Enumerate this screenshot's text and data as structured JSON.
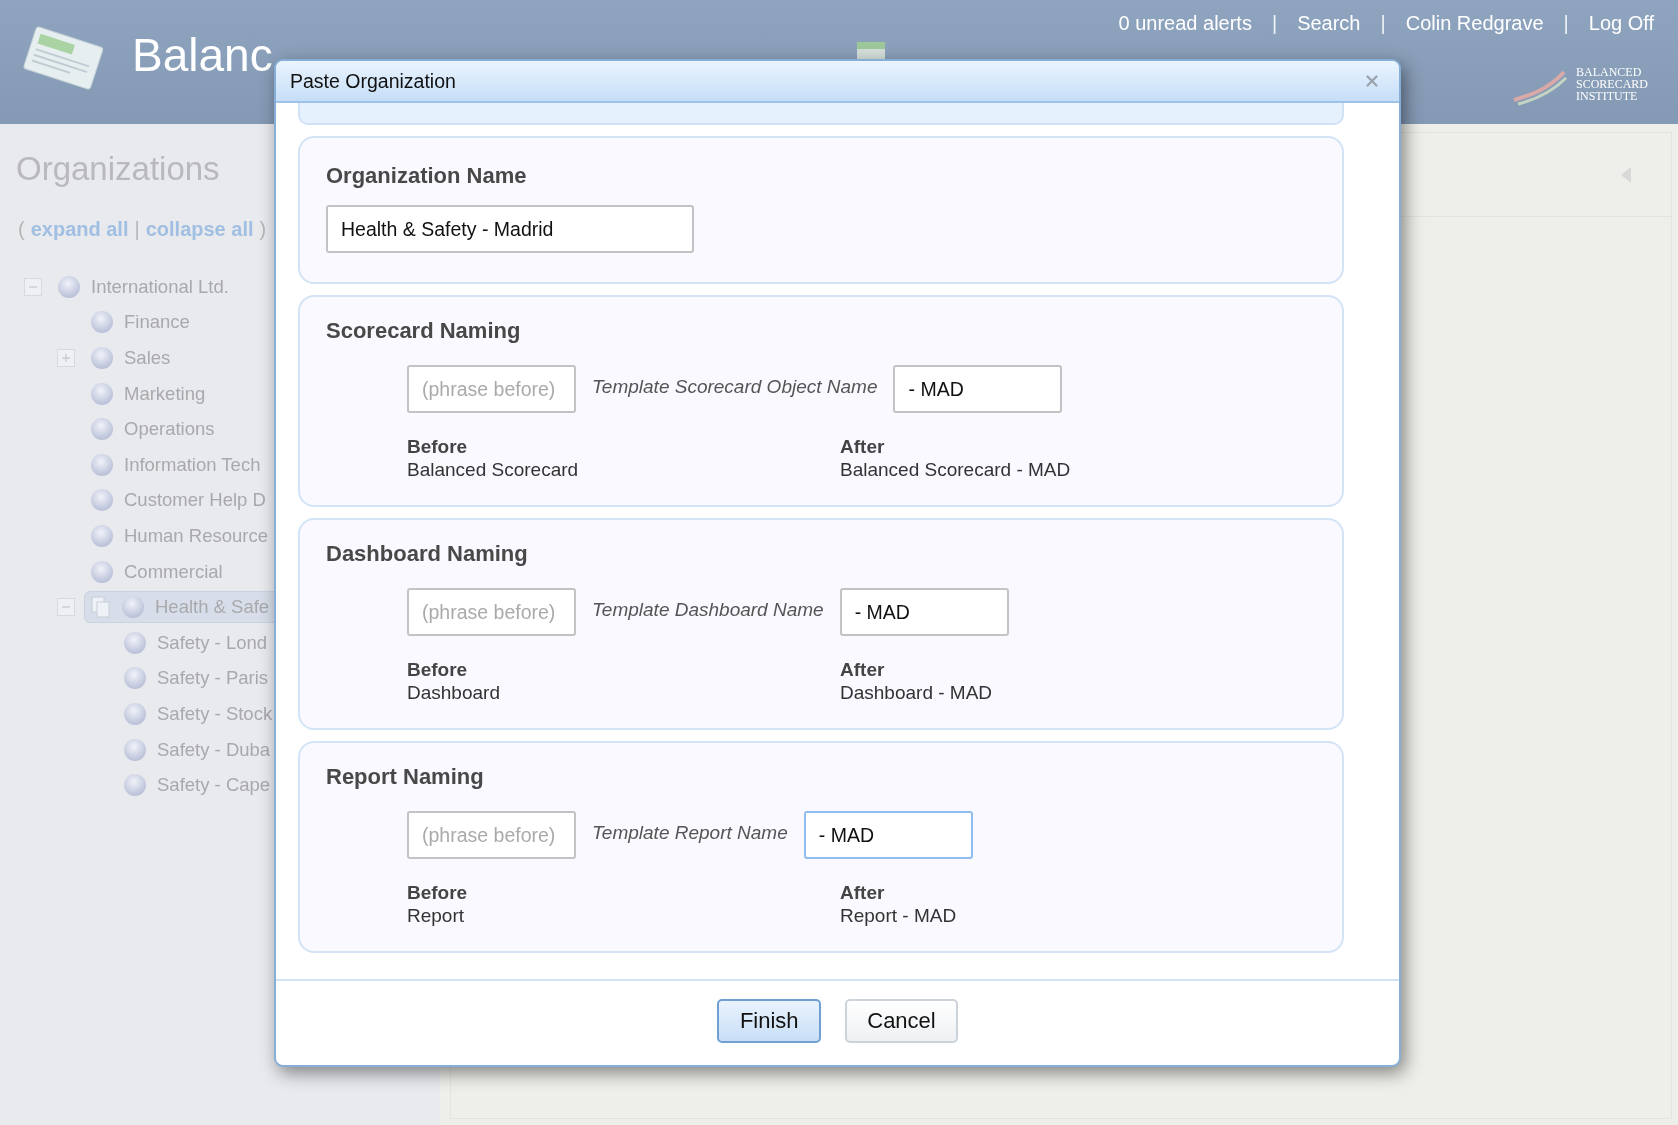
{
  "header": {
    "app_title": "Balanc",
    "top_links": [
      {
        "kind": "link",
        "label": "0 unread alerts"
      },
      {
        "kind": "separator",
        "label": "|"
      },
      {
        "kind": "link",
        "label": "Search"
      },
      {
        "kind": "separator",
        "label": "|"
      },
      {
        "kind": "link",
        "label": "Colin Redgrave"
      },
      {
        "kind": "separator",
        "label": "|"
      },
      {
        "kind": "link",
        "label": "Log Off"
      }
    ],
    "institute_logo": "BALANCED SCORECARD INSTITUTE"
  },
  "sidebar": {
    "title": "Organizations",
    "open_paren": "(",
    "expand_all": "expand all",
    "divider": "|",
    "collapse_all": "collapse all",
    "close_paren": ")",
    "tree": [
      {
        "label": "International Ltd.",
        "selected": false,
        "expanded": true,
        "children": [
          {
            "label": "Finance",
            "selected": false
          },
          {
            "label": "Sales",
            "selected": false,
            "expanded": false
          },
          {
            "label": "Marketing",
            "selected": false
          },
          {
            "label": "Operations",
            "selected": false
          },
          {
            "label": "Information Tech",
            "selected": false
          },
          {
            "label": "Customer Help D",
            "selected": false
          },
          {
            "label": "Human Resource",
            "selected": false
          },
          {
            "label": "Commercial",
            "selected": false
          },
          {
            "label": "Health & Safe",
            "selected": true,
            "expanded": true,
            "clipboard": true,
            "children": [
              {
                "label": "Safety - Lond",
                "selected": false
              },
              {
                "label": "Safety - Paris",
                "selected": false
              },
              {
                "label": "Safety - Stock",
                "selected": false
              },
              {
                "label": "Safety - Duba",
                "selected": false
              },
              {
                "label": "Safety - Cape",
                "selected": false
              }
            ]
          }
        ]
      }
    ]
  },
  "dialog": {
    "title": "Paste Organization",
    "sections": [
      {
        "kind": "name",
        "title": "Organization Name",
        "value": "Health & Safety - Madrid"
      },
      {
        "kind": "naming",
        "title": "Scorecard Naming",
        "prefix_placeholder": "(phrase before)",
        "template_label": "Template Scorecard Object Name",
        "suffix": "- MAD",
        "focused": false,
        "before_label": "Before",
        "before_value": "Balanced Scorecard",
        "after_label": "After",
        "after_value": "Balanced Scorecard - MAD"
      },
      {
        "kind": "naming",
        "title": "Dashboard Naming",
        "prefix_placeholder": "(phrase before)",
        "template_label": "Template Dashboard Name",
        "suffix": "- MAD",
        "focused": false,
        "before_label": "Before",
        "before_value": "Dashboard",
        "after_label": "After",
        "after_value": "Dashboard - MAD"
      },
      {
        "kind": "naming",
        "title": "Report Naming",
        "prefix_placeholder": "(phrase before)",
        "template_label": "Template Report Name",
        "suffix": "- MAD",
        "focused": true,
        "before_label": "Before",
        "before_value": "Report",
        "after_label": "After",
        "after_value": "Report - MAD"
      }
    ],
    "buttons": [
      {
        "label": "Finish",
        "primary": true
      },
      {
        "label": "Cancel",
        "primary": false
      }
    ]
  }
}
